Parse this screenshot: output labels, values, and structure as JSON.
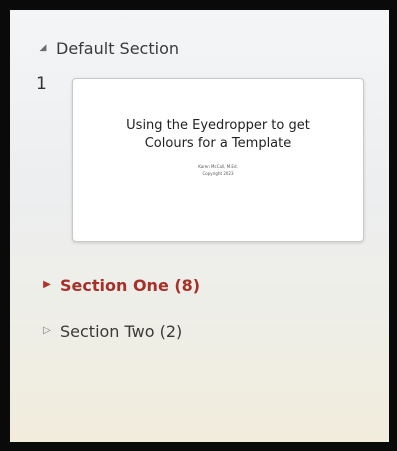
{
  "sections": {
    "default": {
      "caret_icon": "triangle-down-icon",
      "label": "Default Section",
      "expanded": true
    },
    "one": {
      "caret_icon": "triangle-right-filled-icon",
      "label": "Section One (8)",
      "expanded": false,
      "selected": true,
      "color": "#a5312a"
    },
    "two": {
      "caret_icon": "triangle-right-outline-icon",
      "label": "Section Two (2)",
      "expanded": false
    }
  },
  "slides": [
    {
      "number": "1",
      "title_line1": "Using the Eyedropper to get",
      "title_line2": "Colours for a Template",
      "author": "Karen McCall, M.Ed.",
      "copyright": "Copyright 2023"
    }
  ]
}
